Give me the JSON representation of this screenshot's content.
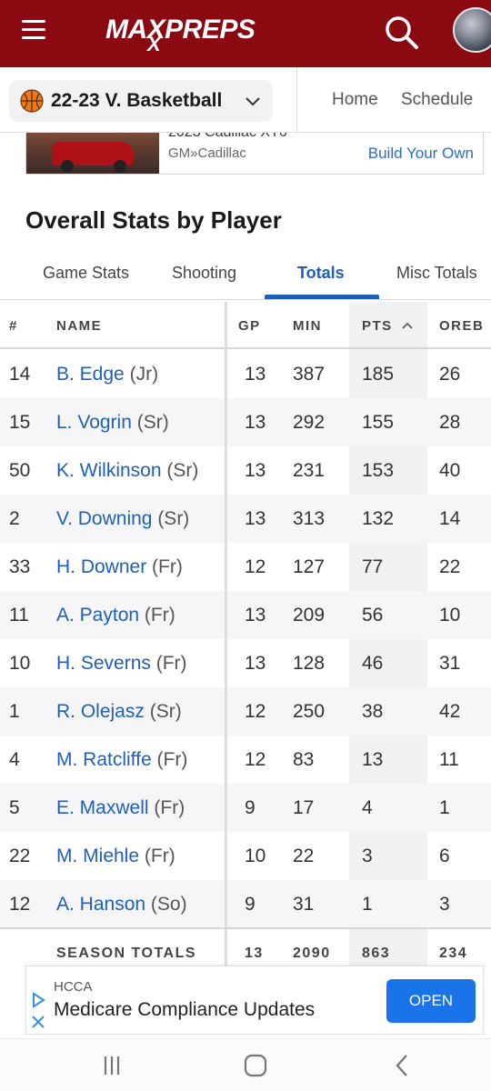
{
  "header": {
    "logo_text": "MAXPREPS",
    "logo_x": "X"
  },
  "colors": {
    "brand": "#8b0a12",
    "link": "#1f5fb8",
    "ad_button": "#1a73e8"
  },
  "subnav": {
    "sport": "22-23 V. Basketball",
    "links": [
      "Home",
      "Schedule"
    ]
  },
  "top_ad": {
    "title_cutoff": "2023 Cadillac XT6",
    "brand": "GM»Cadillac",
    "cta": "Build Your Own"
  },
  "section_title": "Overall Stats by Player",
  "tabs": [
    {
      "label": "Game Stats",
      "active": false
    },
    {
      "label": "Shooting",
      "active": false
    },
    {
      "label": "Totals",
      "active": true
    },
    {
      "label": "Misc Totals",
      "active": false
    }
  ],
  "table": {
    "columns": [
      "#",
      "NAME",
      "GP",
      "MIN",
      "PTS",
      "OREB"
    ],
    "sorted_column": "PTS",
    "rows": [
      {
        "num": "14",
        "name": "B. Edge",
        "cls": "(Jr)",
        "gp": "13",
        "min": "387",
        "pts": "185",
        "oreb": "26"
      },
      {
        "num": "15",
        "name": "L. Vogrin",
        "cls": "(Sr)",
        "gp": "13",
        "min": "292",
        "pts": "155",
        "oreb": "28"
      },
      {
        "num": "50",
        "name": "K. Wilkinson",
        "cls": "(Sr)",
        "gp": "13",
        "min": "231",
        "pts": "153",
        "oreb": "40"
      },
      {
        "num": "2",
        "name": "V. Downing",
        "cls": "(Sr)",
        "gp": "13",
        "min": "313",
        "pts": "132",
        "oreb": "14"
      },
      {
        "num": "33",
        "name": "H. Downer",
        "cls": "(Fr)",
        "gp": "12",
        "min": "127",
        "pts": "77",
        "oreb": "22"
      },
      {
        "num": "11",
        "name": "A. Payton",
        "cls": "(Fr)",
        "gp": "13",
        "min": "209",
        "pts": "56",
        "oreb": "10"
      },
      {
        "num": "10",
        "name": "H. Severns",
        "cls": "(Fr)",
        "gp": "13",
        "min": "128",
        "pts": "46",
        "oreb": "31"
      },
      {
        "num": "1",
        "name": "R. Olejasz",
        "cls": "(Sr)",
        "gp": "12",
        "min": "250",
        "pts": "38",
        "oreb": "42"
      },
      {
        "num": "4",
        "name": "M. Ratcliffe",
        "cls": "(Fr)",
        "gp": "12",
        "min": "83",
        "pts": "13",
        "oreb": "11"
      },
      {
        "num": "5",
        "name": "E. Maxwell",
        "cls": "(Fr)",
        "gp": "9",
        "min": "17",
        "pts": "4",
        "oreb": "1"
      },
      {
        "num": "22",
        "name": "M. Miehle",
        "cls": "(Fr)",
        "gp": "10",
        "min": "22",
        "pts": "3",
        "oreb": "6"
      },
      {
        "num": "12",
        "name": "A. Hanson",
        "cls": "(So)",
        "gp": "9",
        "min": "31",
        "pts": "1",
        "oreb": "3"
      }
    ],
    "totals": {
      "label": "SEASON TOTALS",
      "gp": "13",
      "min": "2090",
      "pts": "863",
      "oreb": "234"
    }
  },
  "bottom_ad": {
    "sponsor": "HCCA",
    "headline": "Medicare Compliance Updates",
    "button": "OPEN"
  },
  "icons": {
    "menu": "hamburger-icon",
    "search": "search-icon",
    "ball": "basketball-icon",
    "dropdown": "chevron-down-icon",
    "sort": "sort-ascending-icon",
    "ad_choices": "ad-choices-icon",
    "ad_close": "close-icon",
    "recents": "recents-icon",
    "home": "home-icon",
    "back": "back-icon"
  }
}
